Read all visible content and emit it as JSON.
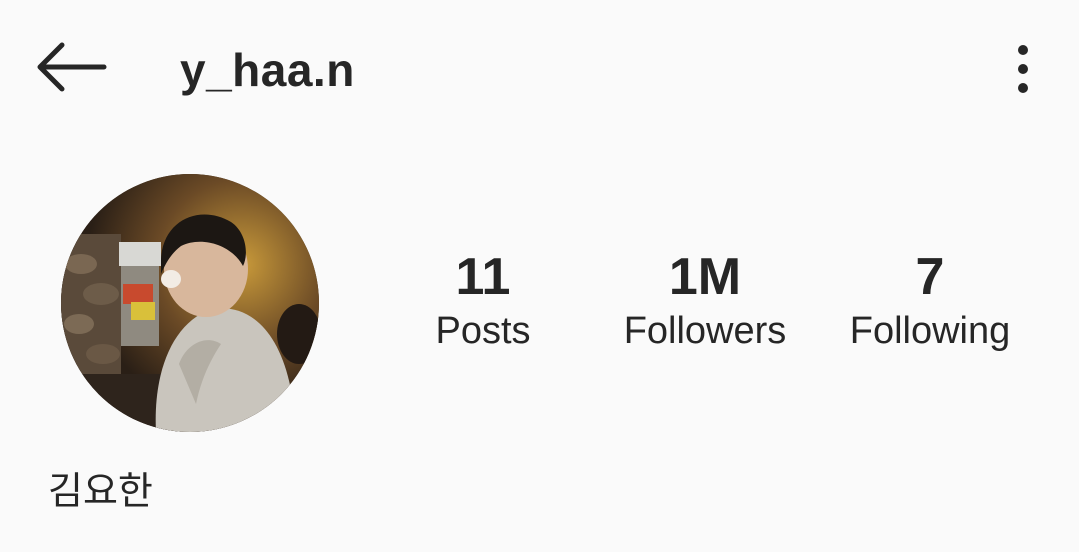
{
  "header": {
    "username": "y_haa.n",
    "back_icon": "arrow-left-icon",
    "more_icon": "more-vertical-icon"
  },
  "profile": {
    "full_name": "김요한",
    "avatar_icon": "profile-photo"
  },
  "stats": [
    {
      "value": "11",
      "label": "Posts"
    },
    {
      "value": "1M",
      "label": "Followers"
    },
    {
      "value": "7",
      "label": "Following"
    }
  ],
  "colors": {
    "background": "#fafafa",
    "text": "#262626"
  }
}
